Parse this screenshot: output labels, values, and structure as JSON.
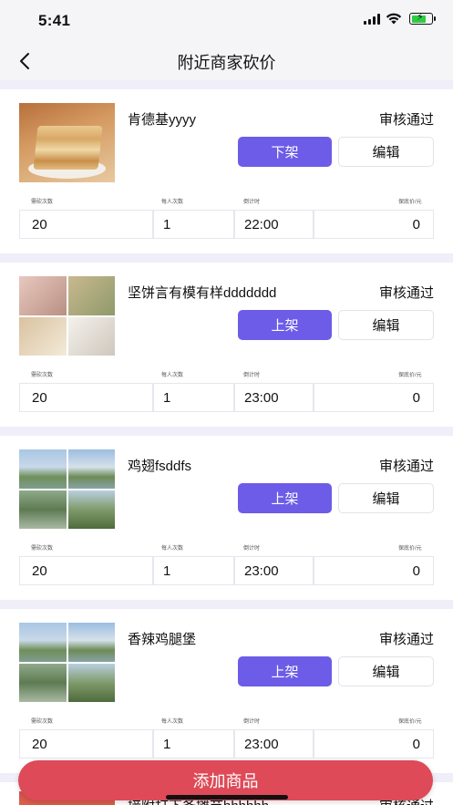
{
  "status_bar": {
    "time": "5:41",
    "icons": [
      "signal-icon",
      "wifi-icon",
      "battery-charging-icon"
    ]
  },
  "nav": {
    "title": "附近商家砍价",
    "back_icon": "chevron-left-icon"
  },
  "field_labels": {
    "total": "需砍次数",
    "per_person": "每人次数",
    "countdown": "倒计时",
    "min_price": "保底价/元"
  },
  "colors": {
    "primary": "#6c5ce7",
    "add_button": "#de4a57",
    "separator": "#efeef9"
  },
  "products": [
    {
      "name": "肯德基yyyy",
      "status": "审核通过",
      "primary_label": "下架",
      "edit_label": "编辑",
      "total": "20",
      "per_person": "1",
      "countdown": "22:00",
      "min_price": "0",
      "image": "food-photo"
    },
    {
      "name": "坚饼言有模有样ddddddd",
      "status": "审核通过",
      "primary_label": "上架",
      "edit_label": "编辑",
      "total": "20",
      "per_person": "1",
      "countdown": "23:00",
      "min_price": "0",
      "image": "dog-photo-grid"
    },
    {
      "name": "鸡翅fsddfs",
      "status": "审核通过",
      "primary_label": "上架",
      "edit_label": "编辑",
      "total": "20",
      "per_person": "1",
      "countdown": "23:00",
      "min_price": "0",
      "image": "lake-photo-grid"
    },
    {
      "name": "香辣鸡腿堡",
      "status": "审核通过",
      "primary_label": "上架",
      "edit_label": "编辑",
      "total": "20",
      "per_person": "1",
      "countdown": "23:00",
      "min_price": "0",
      "image": "lake-photo-grid"
    }
  ],
  "partial_item": {
    "name": "接附打下备摊节hhhhhh",
    "status": "审核通过"
  },
  "add_button": "添加商品"
}
